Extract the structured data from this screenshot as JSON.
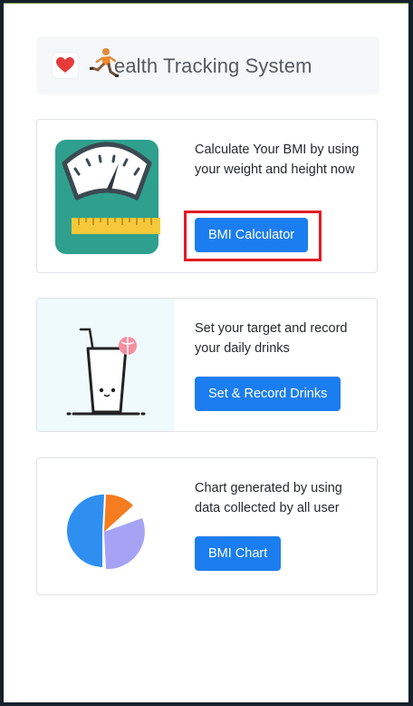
{
  "header": {
    "title": "ealth Tracking System",
    "heart_icon": "heart-icon",
    "runner_icon": "runner-icon"
  },
  "cards": [
    {
      "text": "Calculate Your BMI by using your weight and height now",
      "button_label": "BMI Calculator",
      "image": "weighing-scale-illustration",
      "highlighted": true
    },
    {
      "text": "Set your target and record your daily drinks",
      "button_label": "Set & Record Drinks",
      "image": "drink-glass-illustration"
    },
    {
      "text": "Chart generated by using data collected by all user",
      "button_label": "BMI Chart",
      "image": "pie-chart-illustration"
    }
  ],
  "colors": {
    "button": "#1a7df0",
    "highlight_box": "#e31b23",
    "scale": "#2fa08e",
    "pie_blue": "#2f8ff0",
    "pie_orange": "#f57c1f",
    "pie_purple": "#a6a3f5"
  }
}
